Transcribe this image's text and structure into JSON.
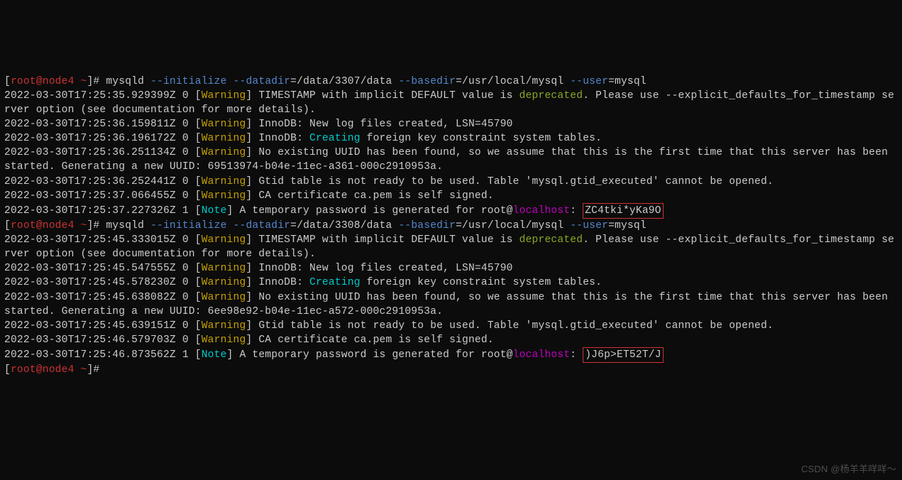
{
  "prompt1": {
    "open": "[",
    "userhost": "root@node4 ~",
    "close": "]# ",
    "cmd": "mysqld ",
    "opt1": "--initialize",
    "sp1": " ",
    "opt2": "--datadir",
    "eq1": "=/data/3307/data ",
    "opt3": "--basedir",
    "eq2": "=/usr/local/mysql ",
    "opt4": "--user",
    "eq3": "=mysql"
  },
  "l1": {
    "ts": "2022-03-30T17:25:35.929399Z 0 [",
    "w": "Warning",
    "a": "] TIMESTAMP with implicit DEFAULT value is ",
    "dep": "deprecated",
    "b": ". Please use --explicit_defaults_for_timestamp server option (see documentation for more details)."
  },
  "l2": {
    "ts": "2022-03-30T17:25:36.159811Z 0 [",
    "w": "Warning",
    "a": "] InnoDB: New log files created, LSN=45790"
  },
  "l3": {
    "ts": "2022-03-30T17:25:36.196172Z 0 [",
    "w": "Warning",
    "a": "] InnoDB: ",
    "c": "Creating",
    "b": " foreign key constraint system tables."
  },
  "l4": {
    "ts": "2022-03-30T17:25:36.251134Z 0 [",
    "w": "Warning",
    "a": "] No existing UUID has been found, so we assume that this is the first time that this server has been started. Generating a new UUID: 69513974-b04e-11ec-a361-000c2910953a."
  },
  "l5": {
    "ts": "2022-03-30T17:25:36.252441Z 0 [",
    "w": "Warning",
    "a": "] Gtid table is not ready to be used. Table 'mysql.gtid_executed' cannot be opened."
  },
  "l6": {
    "ts": "2022-03-30T17:25:37.066455Z 0 [",
    "w": "Warning",
    "a": "] CA certificate ca.pem is self signed."
  },
  "l7": {
    "ts": "2022-03-30T17:25:37.227326Z 1 [",
    "n": "Note",
    "a": "] A temporary password is generated for root@",
    "lh": "localhost",
    "c": ": ",
    "pw": "ZC4tki*yKa9O"
  },
  "prompt2": {
    "open": "[",
    "userhost": "root@node4 ~",
    "close": "]# ",
    "cmd": "mysqld ",
    "opt1": "--initialize",
    "sp1": " ",
    "opt2": "--datadir",
    "eq1": "=/data/3308/data ",
    "opt3": "--basedir",
    "eq2": "=/usr/local/mysql ",
    "opt4": "--user",
    "eq3": "=mysql"
  },
  "m1": {
    "ts": "2022-03-30T17:25:45.333015Z 0 [",
    "w": "Warning",
    "a": "] TIMESTAMP with implicit DEFAULT value is ",
    "dep": "deprecated",
    "b": ". Please use --explicit_defaults_for_timestamp server option (see documentation for more details)."
  },
  "m2": {
    "ts": "2022-03-30T17:25:45.547555Z 0 [",
    "w": "Warning",
    "a": "] InnoDB: New log files created, LSN=45790"
  },
  "m3": {
    "ts": "2022-03-30T17:25:45.578230Z 0 [",
    "w": "Warning",
    "a": "] InnoDB: ",
    "c": "Creating",
    "b": " foreign key constraint system tables."
  },
  "m4": {
    "ts": "2022-03-30T17:25:45.638082Z 0 [",
    "w": "Warning",
    "a": "] No existing UUID has been found, so we assume that this is the first time that this server has been started. Generating a new UUID: 6ee98e92-b04e-11ec-a572-000c2910953a."
  },
  "m5": {
    "ts": "2022-03-30T17:25:45.639151Z 0 [",
    "w": "Warning",
    "a": "] Gtid table is not ready to be used. Table 'mysql.gtid_executed' cannot be opened."
  },
  "m6": {
    "ts": "2022-03-30T17:25:46.579703Z 0 [",
    "w": "Warning",
    "a": "] CA certificate ca.pem is self signed."
  },
  "m7": {
    "ts": "2022-03-30T17:25:46.873562Z 1 [",
    "n": "Note",
    "a": "] A temporary password is generated for root@",
    "lh": "localhost",
    "c": ": ",
    "pw": ")J6p>ET52T/J"
  },
  "prompt3": {
    "open": "[",
    "userhost": "root@node4 ~",
    "close": "]# "
  },
  "watermark": "CSDN @杨羊羊咩咩～"
}
